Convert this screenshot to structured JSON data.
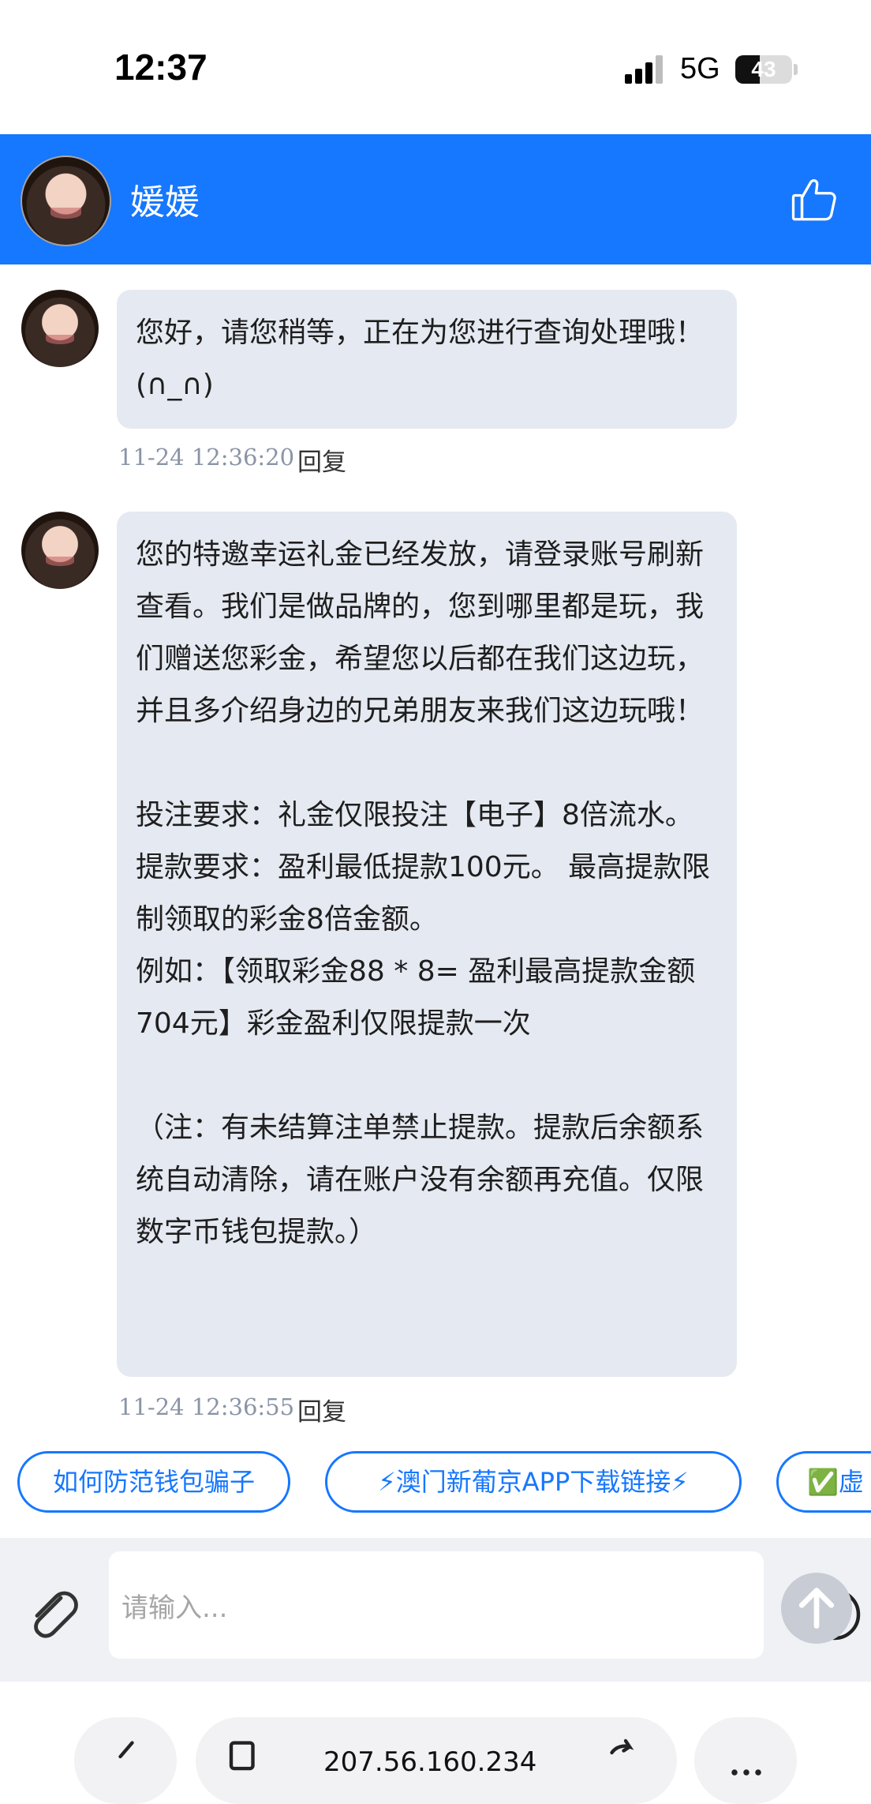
{
  "status_bar": {
    "time": "12:37",
    "network": "5G",
    "battery": "43",
    "battery_level": 0.43
  },
  "header": {
    "title": "媛媛",
    "background_color": "#1677ff",
    "like_icon": "thumbs-up-icon"
  },
  "messages": [
    {
      "paragraphs": [
        "您好，请您稍等，正在为您进行查询处理哦！(∩_∩)"
      ],
      "timestamp": "11-24 12:36:20",
      "reply_label": "回复"
    },
    {
      "paragraphs": [
        "您的特邀幸运礼金已经发放，请登录账号刷新查看。我们是做品牌的，您到哪里都是玩，我们赠送您彩金，希望您以后都在我们这边玩，并且多介绍身边的兄弟朋友来我们这边玩哦！",
        "",
        "投注要求：礼金仅限投注【电子】8倍流水。",
        "提款要求：盈利最低提款100元。 最高提款限制领取的彩金8倍金额。",
        "例如：【领取彩金88 * 8= 盈利最高提款金额704元】彩金盈利仅限提款一次",
        "",
        "（注：有未结算注单禁止提款。提款后余额系统自动清除，请在账户没有余额再充值。仅限数字币钱包提款。）"
      ],
      "timestamp": "11-24 12:36:55",
      "reply_label": "回复"
    }
  ],
  "quick_replies": [
    "如何防范钱包骗子",
    "⚡澳门新葡京APP下载链接⚡",
    "✅虚"
  ],
  "input": {
    "placeholder": "请输入..."
  },
  "browser": {
    "url": "207.56.160.234"
  }
}
